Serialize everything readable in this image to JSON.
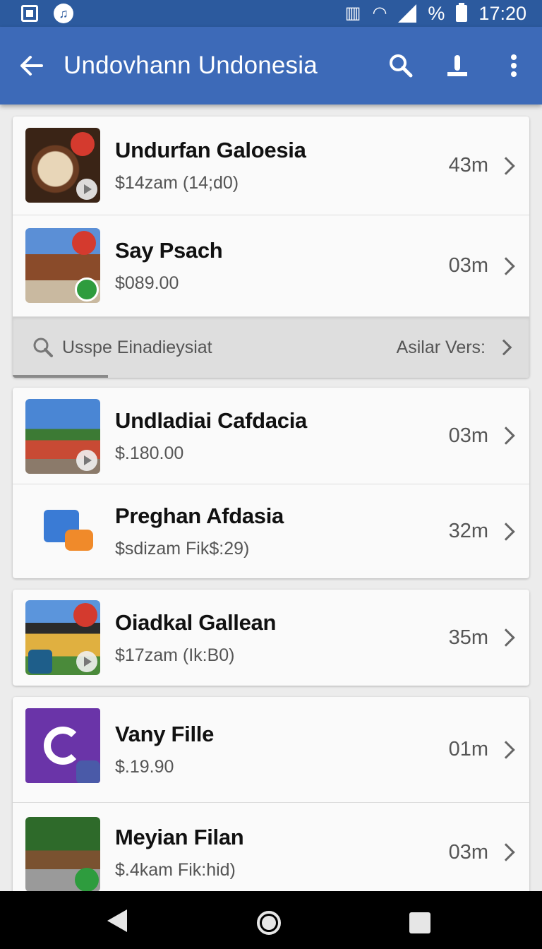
{
  "status_bar": {
    "time": "17:20",
    "percent_icon": "%"
  },
  "app_bar": {
    "title": "Undovhann Undonesia",
    "icons": [
      "back-arrow-icon",
      "search-icon",
      "share-icon",
      "more-vert-icon"
    ]
  },
  "colors": {
    "status_bar": "#2c5a9e",
    "app_bar": "#3d6ab8",
    "background": "#ececec"
  },
  "group1": [
    {
      "name": "Undurfan Galoesia",
      "price": "$14zam (14;d0)",
      "distance": "43m"
    },
    {
      "name": "Say Psach",
      "price": "$089.00",
      "distance": "03m"
    }
  ],
  "search_row": {
    "query": "Usspe Einadieysiat",
    "action": "Asilar Vers:"
  },
  "group2": [
    {
      "name": "Undladiai Cafdacia",
      "price": "$.180.00",
      "distance": "03m"
    },
    {
      "name": "Preghan Afdasia",
      "price": "$sdizam Fik$:29)",
      "distance": "32m"
    }
  ],
  "group3": [
    {
      "name": "Oiadkal Gallean",
      "price": "$17zam (Ik:B0)",
      "distance": "35m"
    }
  ],
  "group4": [
    {
      "name": "Vany Fille",
      "price": "$.19.90",
      "distance": "01m"
    },
    {
      "name": "Meyian Filan",
      "price": "$.4kam Fik:hid)",
      "distance": "03m"
    }
  ]
}
